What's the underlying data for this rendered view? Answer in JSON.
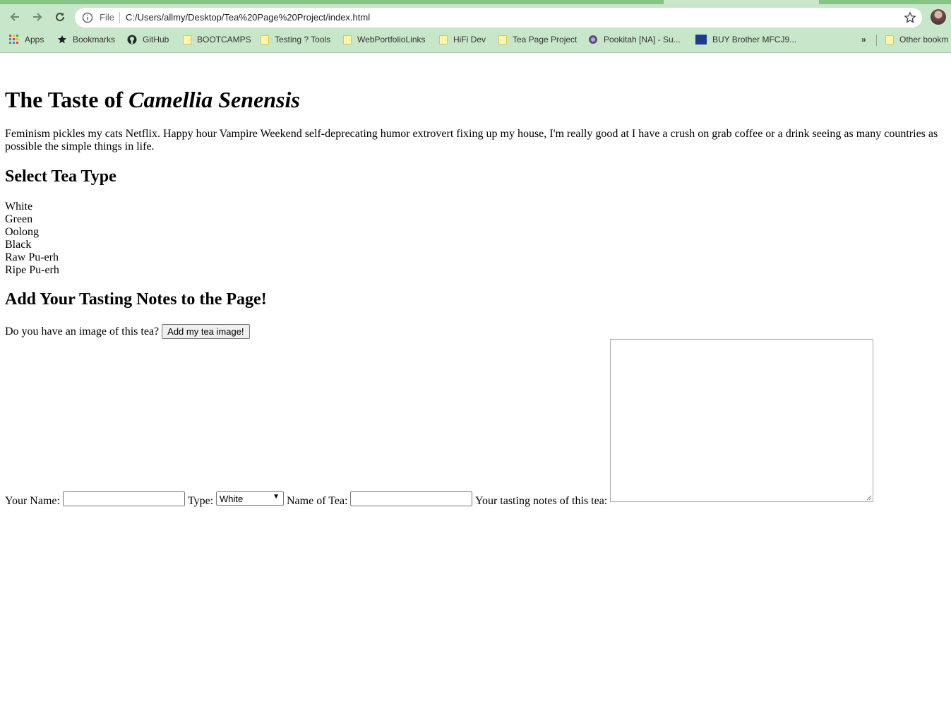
{
  "browser": {
    "scheme_label": "File",
    "url": "C:/Users/allmy/Desktop/Tea%20Page%20Project/index.html",
    "icons": [
      "back-arrow-icon",
      "forward-arrow-icon",
      "reload-icon",
      "info-icon",
      "star-icon",
      "profile-avatar"
    ],
    "bookmarks": [
      {
        "label": "Apps",
        "icon": "apps-grid-icon"
      },
      {
        "label": "Bookmarks",
        "icon": "star-icon"
      },
      {
        "label": "GitHub",
        "icon": "github-icon"
      },
      {
        "label": "BOOTCAMPS",
        "icon": "folder-icon"
      },
      {
        "label": "Testing ? Tools",
        "icon": "folder-icon"
      },
      {
        "label": "WebPortfolioLinks",
        "icon": "folder-icon"
      },
      {
        "label": "HiFi Dev",
        "icon": "folder-icon"
      },
      {
        "label": "Tea Page Project",
        "icon": "folder-icon"
      },
      {
        "label": "Pookitah [NA] - Su...",
        "icon": "game-icon"
      },
      {
        "label": "BUY Brother MFCJ9...",
        "icon": "brother-icon"
      },
      {
        "label": "Other bookm",
        "icon": "folder-icon"
      }
    ],
    "overflow_label": "»",
    "colors": {
      "chrome": "#c8e6c9",
      "tab_accent": "#86c488"
    }
  },
  "page": {
    "title_plain": "The Taste of ",
    "title_italic": "Camellia Senensis",
    "intro": "Feminism pickles my cats Netflix. Happy hour Vampire Weekend self-deprecating humor extrovert fixing up my house, I'm really good at I have a crush on grab coffee or a drink seeing as many countries as possible the simple things in life.",
    "select_heading": "Select Tea Type",
    "tea_types": [
      "White",
      "Green",
      "Oolong",
      "Black",
      "Raw Pu-erh",
      "Ripe Pu-erh"
    ],
    "notes_heading": "Add Your Tasting Notes to the Page!",
    "image_prompt": "Do you have an image of this tea?",
    "image_button": "Add my tea image!",
    "form": {
      "name_label": "Your Name:",
      "name_value": "",
      "type_label": "Type:",
      "type_selected": "White",
      "tea_name_label": "Name of Tea:",
      "tea_name_value": "",
      "notes_label": "Your tasting notes of this tea:",
      "notes_value": ""
    }
  }
}
